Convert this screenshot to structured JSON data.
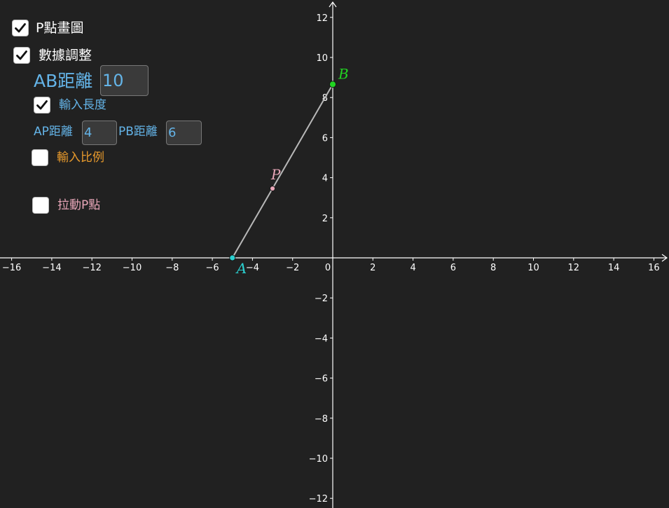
{
  "controls": {
    "p_draw": {
      "label": "P點畫圖",
      "checked": true
    },
    "data_adjust": {
      "label": "數據調整",
      "checked": true
    },
    "ab_distance": {
      "label": "AB距離",
      "value": "10"
    },
    "input_length": {
      "label": "輸入長度",
      "checked": true
    },
    "ap_distance": {
      "label": "AP距離",
      "value": "4"
    },
    "pb_distance": {
      "label": "PB距離",
      "value": "6"
    },
    "input_ratio": {
      "label": "輸入比例",
      "checked": false
    },
    "drag_p": {
      "label": "拉動P點",
      "checked": false
    }
  },
  "axes": {
    "x_ticks": [
      "−16",
      "−14",
      "−12",
      "−10",
      "−8",
      "−6",
      "−4",
      "−2",
      "0",
      "2",
      "4",
      "6",
      "8",
      "10",
      "12",
      "14",
      "16"
    ],
    "y_ticks": [
      "12",
      "10",
      "8",
      "6",
      "4",
      "2",
      "−2",
      "−4",
      "−6",
      "−8",
      "−10",
      "−12"
    ]
  },
  "points": {
    "A": {
      "label": "A",
      "x": -5,
      "y": 0,
      "color": "#2bd1d1"
    },
    "B": {
      "label": "B",
      "x": 0,
      "y": 8.66,
      "color": "#22d422"
    },
    "P": {
      "label": "P",
      "x": -3,
      "y": 3.46,
      "color": "#e8a6b8"
    }
  },
  "colors": {
    "background": "#212121",
    "axis": "#ffffff",
    "segment": "#b8b8b8",
    "label_blue": "#64b4e8",
    "label_orange": "#e89a2c",
    "label_pink": "#e8a6b8"
  }
}
